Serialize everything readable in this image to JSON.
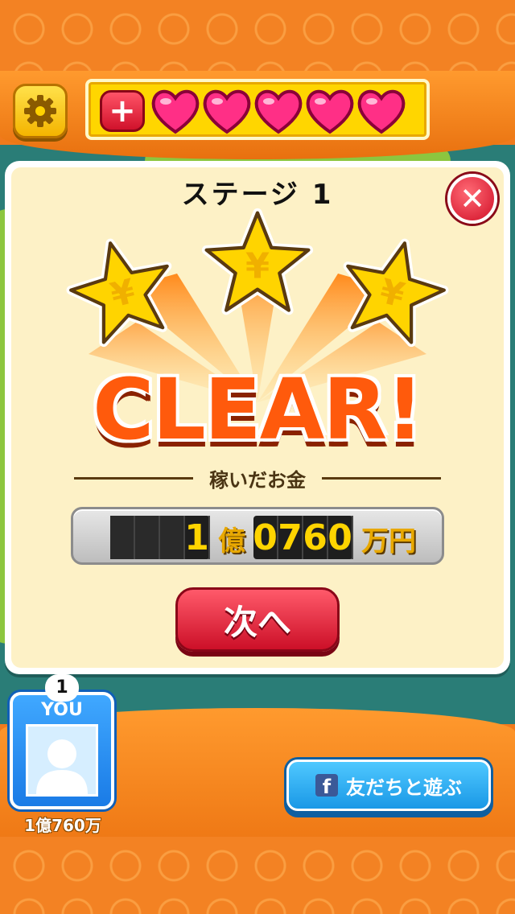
{
  "stage": {
    "title": "ステージ 1"
  },
  "result": {
    "stars_earned": 3,
    "stars_total": 3,
    "clear_text": "CLEAR!",
    "earned_label": "稼いだお金",
    "counter": {
      "oku_digits": [
        "",
        "",
        "",
        "1"
      ],
      "oku_unit": "億",
      "man_digits": [
        "0",
        "7",
        "6",
        "0"
      ],
      "man_unit": "万円"
    },
    "next_label": "次へ"
  },
  "player": {
    "rank": "1",
    "you_label": "YOU",
    "score": "1億760万"
  },
  "social": {
    "facebook_label": "友だちと遊ぶ",
    "fb_glyph": "f"
  },
  "hud": {
    "add_lives_glyph": "+",
    "lives": 5
  },
  "colors": {
    "background_orange": "#f38223",
    "dialog_bg": "#fdf1c6",
    "accent_red": "#d0122b",
    "star_gold": "#ffd400",
    "fb_blue": "#1a98e6"
  }
}
